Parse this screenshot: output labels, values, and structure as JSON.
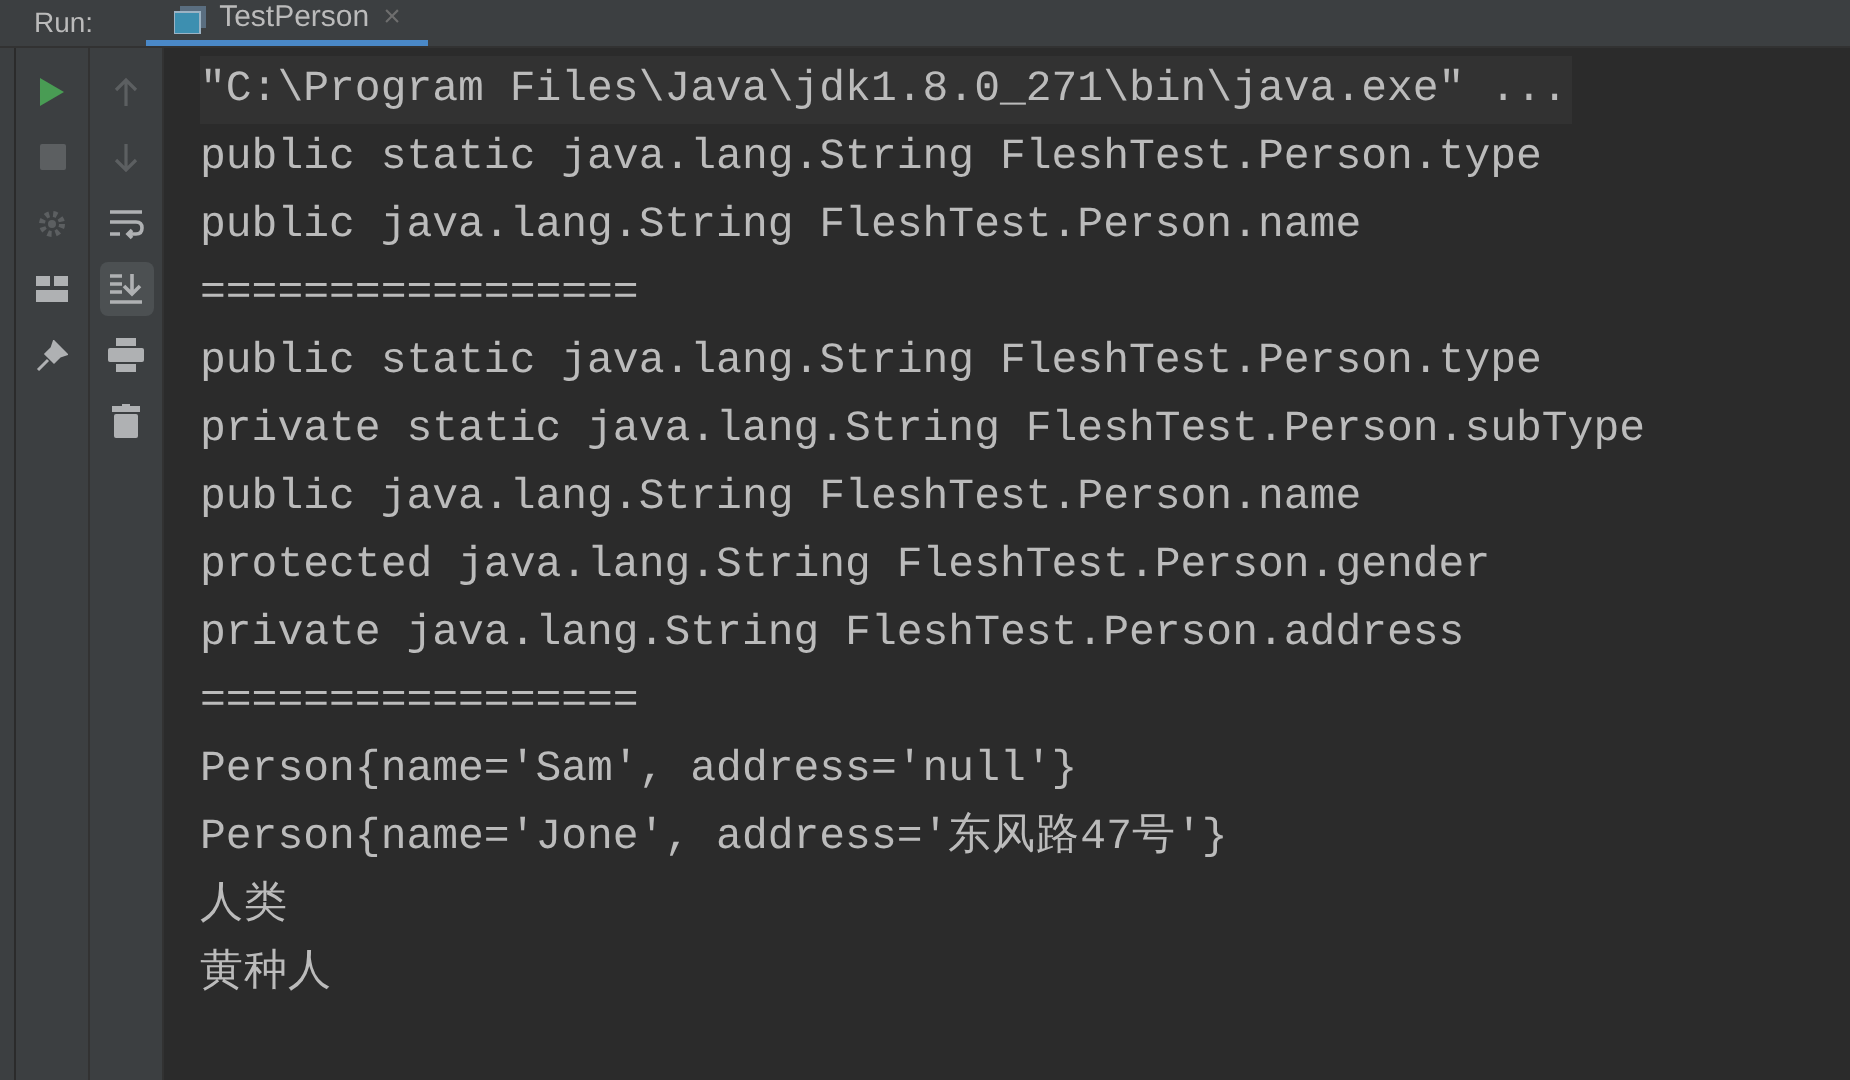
{
  "run_bar": {
    "label": "Run:",
    "tabs": [
      {
        "title": "TestPerson",
        "selected": true,
        "close": "×"
      }
    ]
  },
  "left_toolbar": [
    {
      "kind": "run",
      "disabled": false
    },
    {
      "kind": "stop",
      "disabled": true
    },
    {
      "kind": "debug",
      "disabled": true
    },
    {
      "kind": "layout",
      "disabled": false
    },
    {
      "kind": "pin",
      "disabled": false
    }
  ],
  "right_toolbar": [
    {
      "kind": "up",
      "disabled": true,
      "selected": false
    },
    {
      "kind": "down",
      "disabled": true,
      "selected": false
    },
    {
      "kind": "wrap",
      "disabled": false,
      "selected": false
    },
    {
      "kind": "scroll-end",
      "disabled": false,
      "selected": true
    },
    {
      "kind": "print",
      "disabled": false,
      "selected": false
    },
    {
      "kind": "trash",
      "disabled": false,
      "selected": false
    }
  ],
  "console": [
    {
      "kind": "command",
      "text": "\"C:\\Program Files\\Java\\jdk1.8.0_271\\bin\\java.exe\" ..."
    },
    {
      "kind": "output",
      "text": "public static java.lang.String FleshTest.Person.type"
    },
    {
      "kind": "output",
      "text": "public java.lang.String FleshTest.Person.name"
    },
    {
      "kind": "output",
      "text": "================="
    },
    {
      "kind": "output",
      "text": "public static java.lang.String FleshTest.Person.type"
    },
    {
      "kind": "output",
      "text": "private static java.lang.String FleshTest.Person.subType"
    },
    {
      "kind": "output",
      "text": "public java.lang.String FleshTest.Person.name"
    },
    {
      "kind": "output",
      "text": "protected java.lang.String FleshTest.Person.gender"
    },
    {
      "kind": "output",
      "text": "private java.lang.String FleshTest.Person.address"
    },
    {
      "kind": "output",
      "text": "================="
    },
    {
      "kind": "output",
      "text": "Person{name='Sam', address='null'}"
    },
    {
      "kind": "output",
      "text": "Person{name='Jone', address='东风路47号'}"
    },
    {
      "kind": "output",
      "text": "人类"
    },
    {
      "kind": "output",
      "text": "黄种人"
    }
  ]
}
